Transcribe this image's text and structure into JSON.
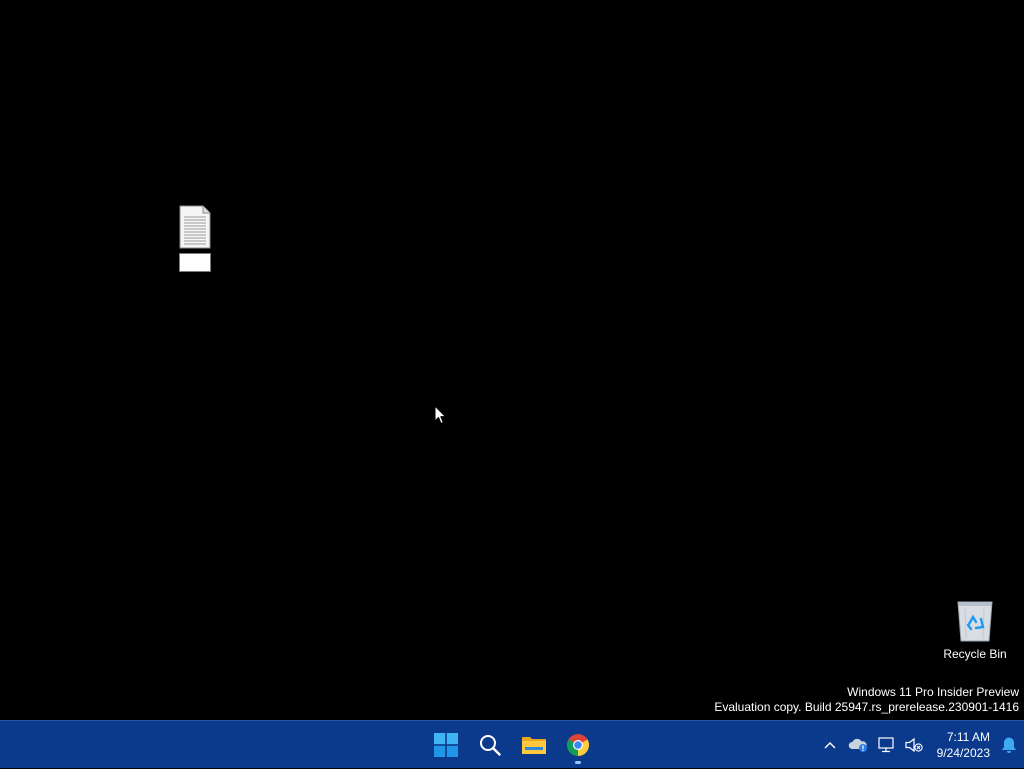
{
  "desktop": {
    "file_icon": {
      "icon": "text-document-icon",
      "rename_value": ""
    },
    "recycle_bin": {
      "icon": "recycle-bin-icon",
      "label": "Recycle Bin"
    },
    "watermark": {
      "line1": "Windows 11 Pro Insider Preview",
      "line2": "Evaluation copy. Build 25947.rs_prerelease.230901-1416"
    }
  },
  "taskbar": {
    "apps": [
      {
        "name": "Start",
        "icon": "windows-logo-icon"
      },
      {
        "name": "Search",
        "icon": "search-icon"
      },
      {
        "name": "File Explorer",
        "icon": "folder-icon"
      },
      {
        "name": "Google Chrome",
        "icon": "chrome-icon",
        "running": true
      }
    ],
    "tray": {
      "icons": [
        "chevron-up-icon",
        "onedrive-icon",
        "network-icon",
        "volume-muted-icon",
        "bell-icon"
      ],
      "time": "7:11 AM",
      "date": "9/24/2023"
    }
  },
  "colors": {
    "taskbar_bg": "#0b3a8c",
    "desktop_bg": "#000000",
    "accent": "#1a9bf0"
  }
}
